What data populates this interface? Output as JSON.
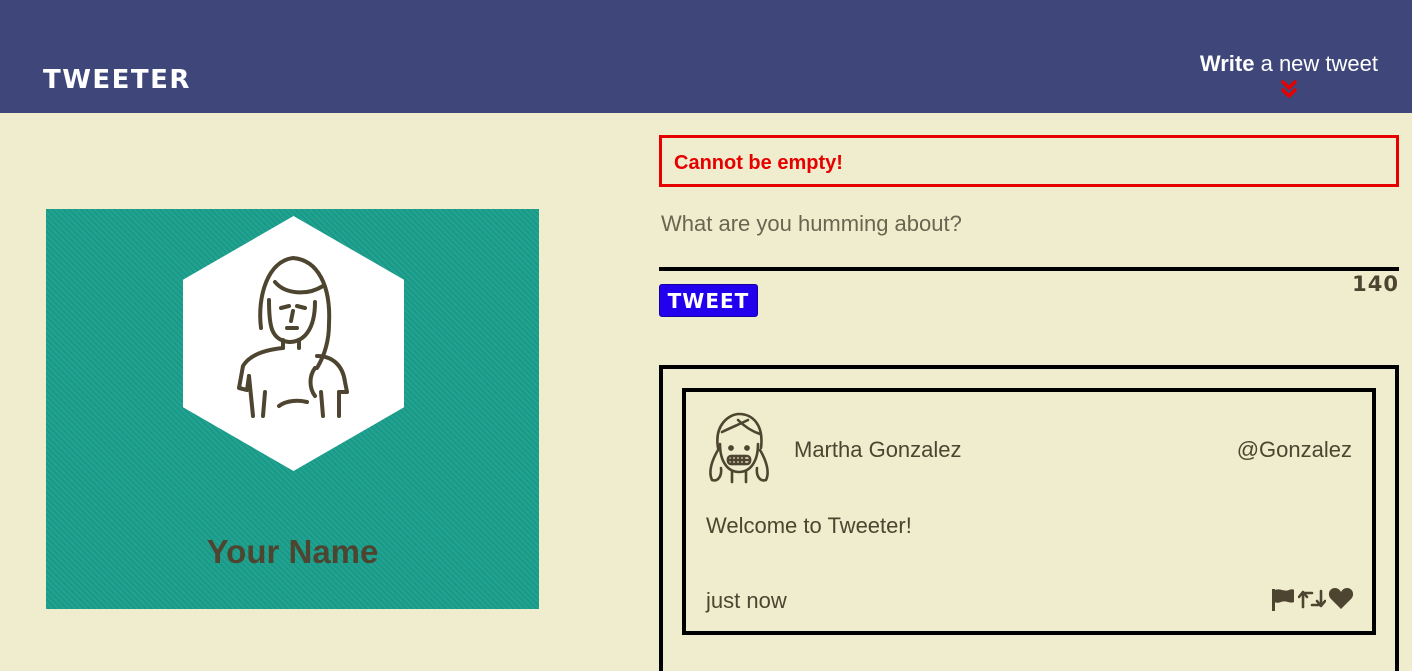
{
  "app": {
    "brand": "TWEETER"
  },
  "nav": {
    "compose_bold": "Write",
    "compose_rest": " a new tweet",
    "compose_icon": "double-chevron-down-icon",
    "compose_icon_color": "#e60000"
  },
  "profile": {
    "name": "Your Name",
    "avatar_icon": "woman-avatar-icon",
    "card_color": "#1a9e8c"
  },
  "composer": {
    "error": "Cannot be empty!",
    "placeholder": "What are you humming about?",
    "value": "",
    "button_label": "TWEET",
    "counter": "140"
  },
  "feed": {
    "tweets": [
      {
        "author_name": "Martha Gonzalez",
        "handle": "@Gonzalez",
        "body": "Welcome to Tweeter!",
        "time": "just now",
        "avatar_icon": "girl-avatar-icon",
        "actions": [
          "flag-icon",
          "retweet-icon",
          "heart-icon"
        ]
      }
    ]
  },
  "colors": {
    "nav": "#3f477a",
    "background": "#efedce",
    "text": "#4e4530",
    "error": "#e60000",
    "button": "#2200ee"
  }
}
